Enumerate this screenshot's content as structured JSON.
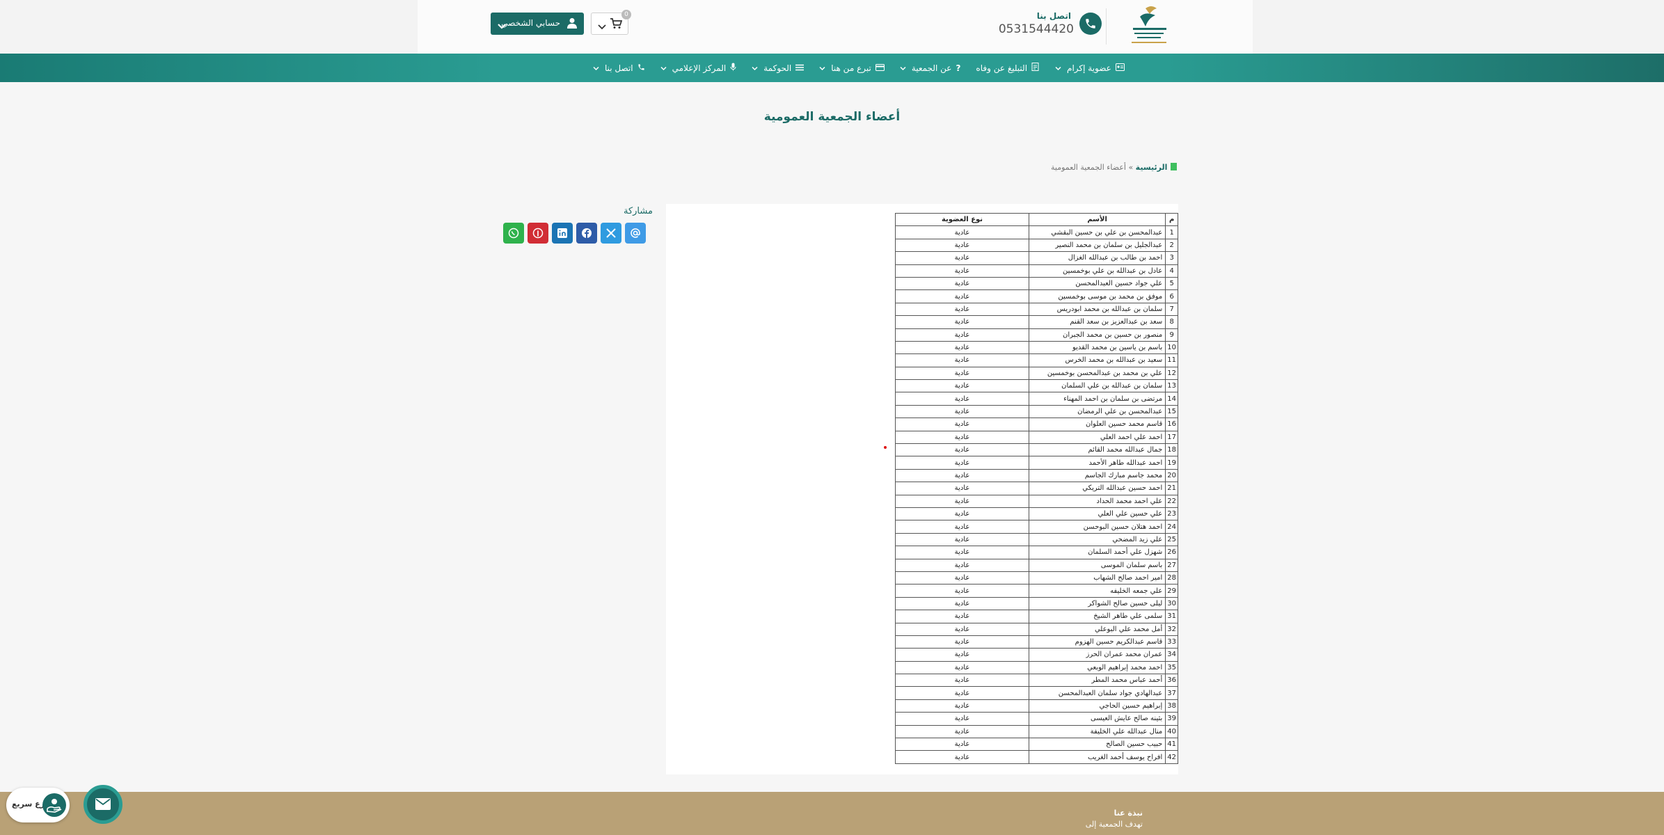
{
  "header": {
    "contact_label": "اتصل بنا",
    "contact_phone": "0531544420",
    "account_label": "حسابي الشخصي",
    "cart_count": "0"
  },
  "nav": {
    "items": [
      {
        "label": "عضوية إكرام",
        "dropdown": true
      },
      {
        "label": "التبليغ عن وفاه",
        "dropdown": false
      },
      {
        "label": "عن الجمعية",
        "dropdown": true
      },
      {
        "label": "تبرع من هنا",
        "dropdown": true
      },
      {
        "label": "الحوكمة",
        "dropdown": true
      },
      {
        "label": "المركز الإعلامي",
        "dropdown": true
      },
      {
        "label": "اتصل بنا",
        "dropdown": true
      }
    ]
  },
  "page": {
    "title": "أعضاء الجمعية العمومية",
    "breadcrumb_home": "الرئيسية",
    "breadcrumb_sep": "»",
    "breadcrumb_current": "أعضاء الجمعية العمومية",
    "share_label": "مشاركة"
  },
  "table": {
    "headers": {
      "num": "م",
      "name": "الأسم",
      "type": "نوع العضوية"
    },
    "rows": [
      {
        "num": "1",
        "name": "عبدالمحسن بن علي بن حسين البقشي",
        "type": "عادية"
      },
      {
        "num": "2",
        "name": "عبدالجليل بن سلمان بن محمد النصير",
        "type": "عادية"
      },
      {
        "num": "3",
        "name": "احمد بن طالب بن عبدالله الغزال",
        "type": "عادية"
      },
      {
        "num": "4",
        "name": "عادل بن عبدالله بن علي بوخمسين",
        "type": "عادية"
      },
      {
        "num": "5",
        "name": "علي جواد حسين العبدالمحسن",
        "type": "عادية"
      },
      {
        "num": "6",
        "name": "موفق بن محمد بن موسى بوخمسين",
        "type": "عادية"
      },
      {
        "num": "7",
        "name": "سلمان بن عبدالله بن محمد ابودريس",
        "type": "عادية"
      },
      {
        "num": "8",
        "name": "سعد بن عبدالعزيز بن سعد القنم",
        "type": "عادية"
      },
      {
        "num": "9",
        "name": "منصور بن حسين بن محمد الجبران",
        "type": "عادية"
      },
      {
        "num": "10",
        "name": "باسم بن ياسين بن محمد القديو",
        "type": "عادية"
      },
      {
        "num": "11",
        "name": "سعيد بن عبدالله بن محمد الخرس",
        "type": "عادية"
      },
      {
        "num": "12",
        "name": "علي بن محمد بن عبدالمحسن بوخمسين",
        "type": "عادية"
      },
      {
        "num": "13",
        "name": "سلمان بن عبدالله بن علي السلمان",
        "type": "عادية"
      },
      {
        "num": "14",
        "name": "مرتضى بن سلمان بن احمد المهناء",
        "type": "عادية"
      },
      {
        "num": "15",
        "name": "عبدالمحسن بن علي الرمضان",
        "type": "عادية"
      },
      {
        "num": "16",
        "name": "قاسم محمد حسين العلوان",
        "type": "عادية"
      },
      {
        "num": "17",
        "name": "احمد علي احمد العلي",
        "type": "عادية"
      },
      {
        "num": "18",
        "name": "جمال عبدالله محمد القائم",
        "type": "عادية"
      },
      {
        "num": "19",
        "name": "احمد عبدالله طاهر الأحمد",
        "type": "عادية"
      },
      {
        "num": "20",
        "name": "محمد جاسم مبارك الجاسم",
        "type": "عادية"
      },
      {
        "num": "21",
        "name": "احمد حسين عبدالله التريكي",
        "type": "عادية"
      },
      {
        "num": "22",
        "name": "علي احمد محمد الحداد",
        "type": "عادية"
      },
      {
        "num": "23",
        "name": "علي حسين علي العلي",
        "type": "عادية"
      },
      {
        "num": "24",
        "name": "احمد هتلان حسين البوحسن",
        "type": "عادية"
      },
      {
        "num": "25",
        "name": "علي زيد المضحي",
        "type": "عادية"
      },
      {
        "num": "26",
        "name": "شهزل علي أحمد السلمان",
        "type": "عادية"
      },
      {
        "num": "27",
        "name": "باسم سلمان الموسى",
        "type": "عادية"
      },
      {
        "num": "28",
        "name": "امير احمد صالح الشهاب",
        "type": "عادية"
      },
      {
        "num": "29",
        "name": "علي جمعه الخليفه",
        "type": "عادية"
      },
      {
        "num": "30",
        "name": "ليلى حسين صالح الشواكر",
        "type": "عادية"
      },
      {
        "num": "31",
        "name": "سلمى علي طاهر الشيخ",
        "type": "عادية"
      },
      {
        "num": "32",
        "name": "أمل محمد علي البوعلي",
        "type": "عادية"
      },
      {
        "num": "33",
        "name": "قاسم عبدالكريم حسين الهزوم",
        "type": "عادية"
      },
      {
        "num": "34",
        "name": "عمران محمد عمران الحرز",
        "type": "عادية"
      },
      {
        "num": "35",
        "name": "احمد محمد إبراهيم الوبعي",
        "type": "عادية"
      },
      {
        "num": "36",
        "name": "أحمد عباس محمد المطر",
        "type": "عادية"
      },
      {
        "num": "37",
        "name": "عبدالهادي جواد سلمان العبدالمحسن",
        "type": "عادية"
      },
      {
        "num": "38",
        "name": "إبراهيم حسين الحاجي",
        "type": "عادية"
      },
      {
        "num": "39",
        "name": "بثينه صالح عايش العيسى",
        "type": "عادية"
      },
      {
        "num": "40",
        "name": "منال عبدالله علي الخليفة",
        "type": "عادية"
      },
      {
        "num": "41",
        "name": "حبيب حسين الصالح",
        "type": "عادية"
      },
      {
        "num": "42",
        "name": "افراح يوسف أحمد الغريب",
        "type": "عادية"
      }
    ]
  },
  "footer": {
    "about_title": "نبذة عنا",
    "about_text": "تهدف الجمعية إلى"
  },
  "floating": {
    "donate_label": "تبرع سريع"
  },
  "colors": {
    "brand": "#1b6b66",
    "nav": "#2a9c92",
    "footer": "#b9a176"
  }
}
